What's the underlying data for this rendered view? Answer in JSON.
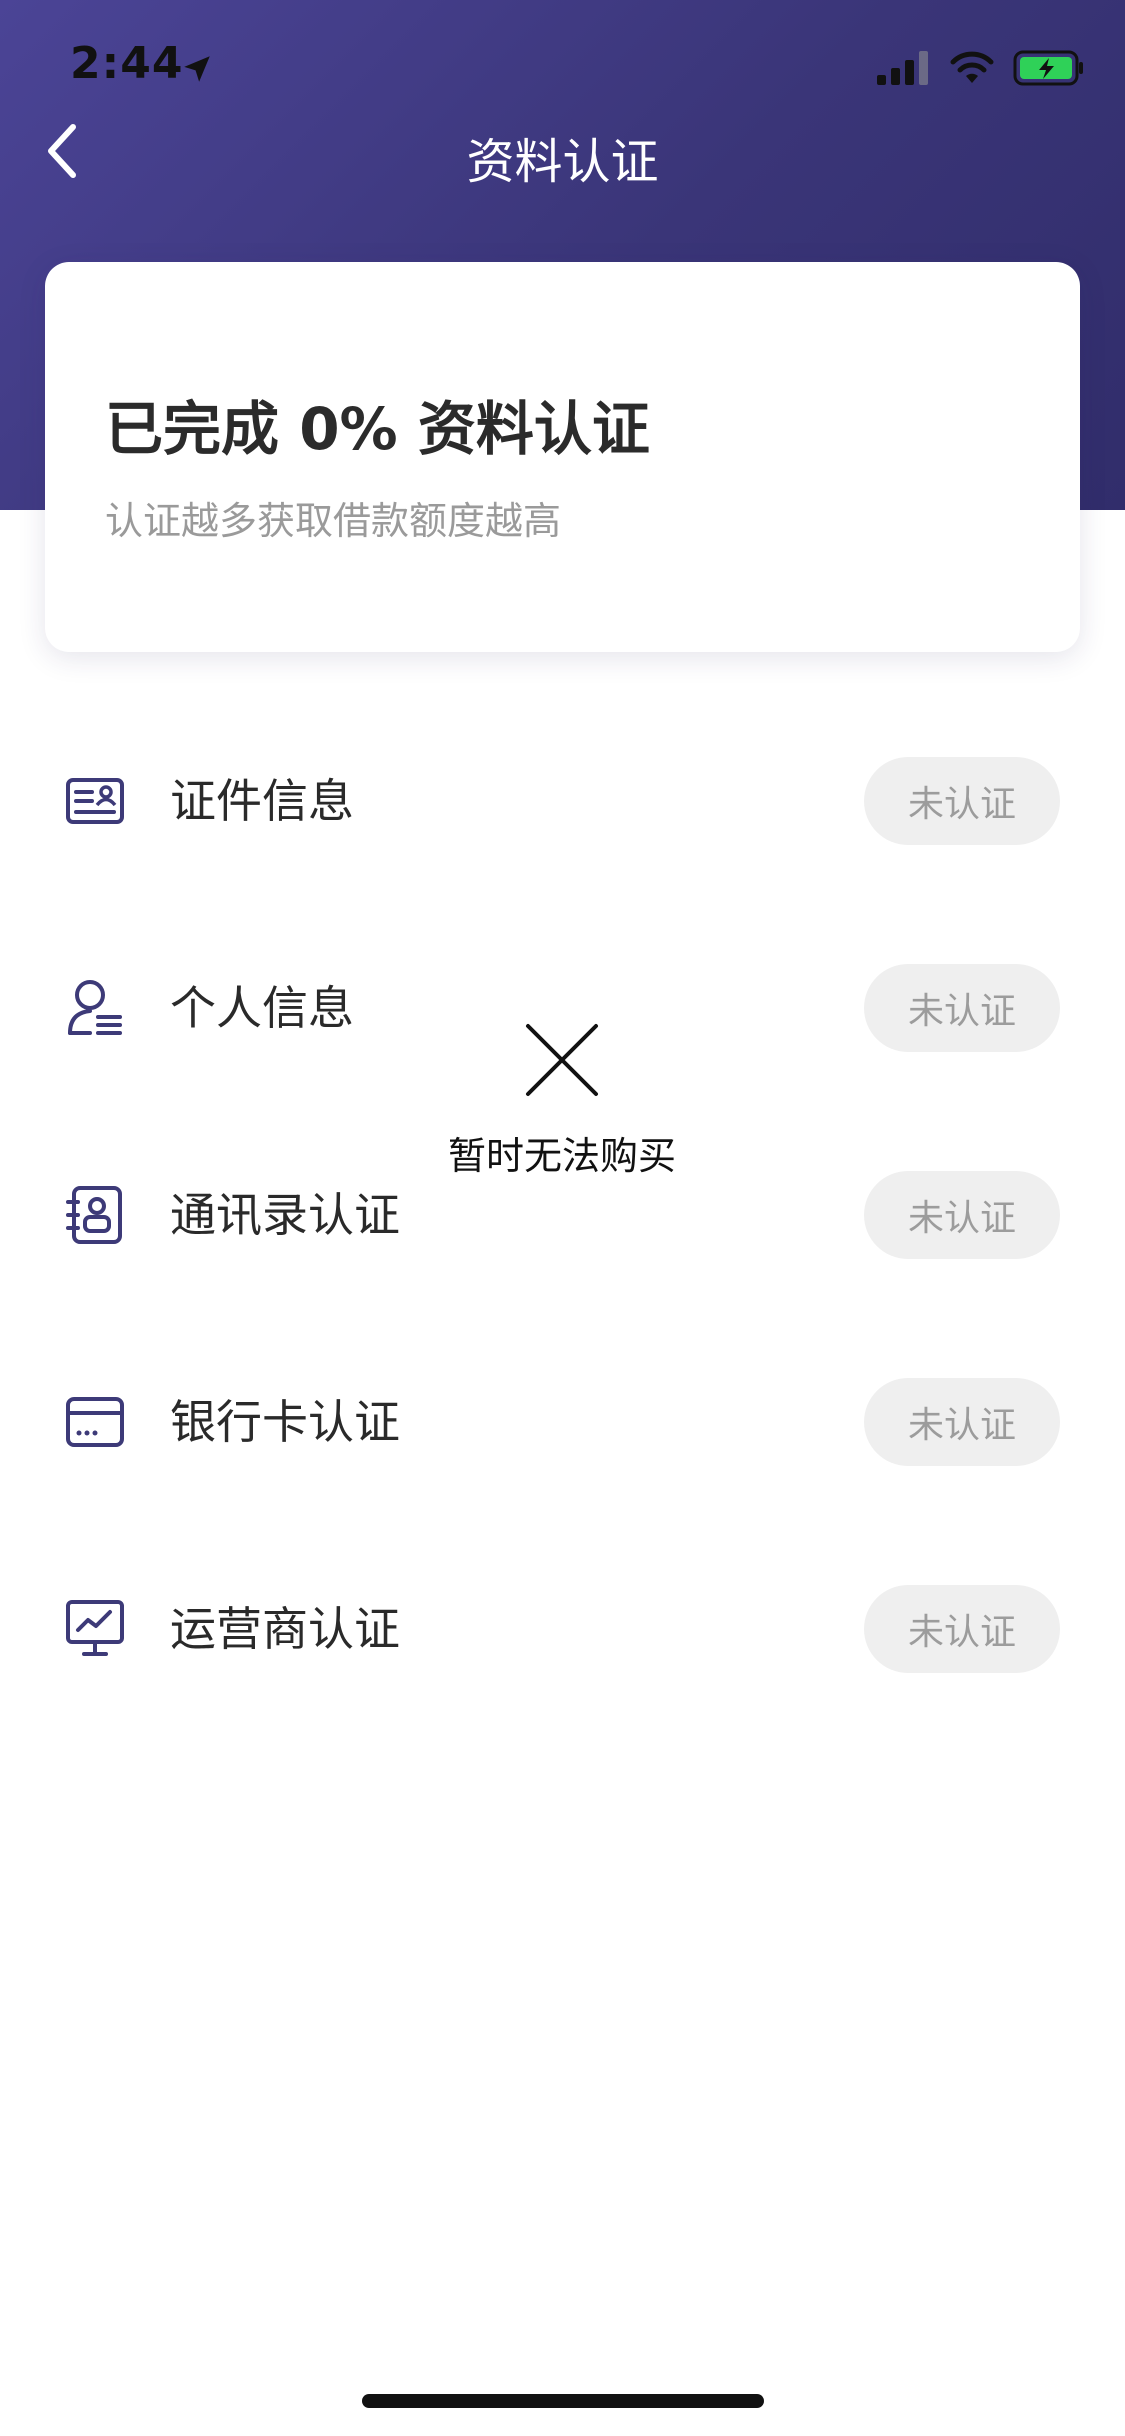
{
  "status_bar": {
    "time": "2:44"
  },
  "nav": {
    "title": "资料认证"
  },
  "summary": {
    "title": "已完成 0% 资料认证",
    "subtitle": "认证越多获取借款额度越高"
  },
  "items": [
    {
      "label": "证件信息",
      "status": "未认证",
      "icon": "id-card-icon"
    },
    {
      "label": "个人信息",
      "status": "未认证",
      "icon": "person-info-icon"
    },
    {
      "label": "通讯录认证",
      "status": "未认证",
      "icon": "contacts-icon"
    },
    {
      "label": "银行卡认证",
      "status": "未认证",
      "icon": "bank-card-icon"
    },
    {
      "label": "运营商认证",
      "status": "未认证",
      "icon": "carrier-icon"
    }
  ],
  "toast": {
    "message": "暂时无法购买"
  },
  "colors": {
    "header_start": "#4b4496",
    "header_end": "#312d6b",
    "icon": "#3d3a78",
    "pill_bg": "#efefef",
    "pill_text": "#9c9c9c"
  }
}
